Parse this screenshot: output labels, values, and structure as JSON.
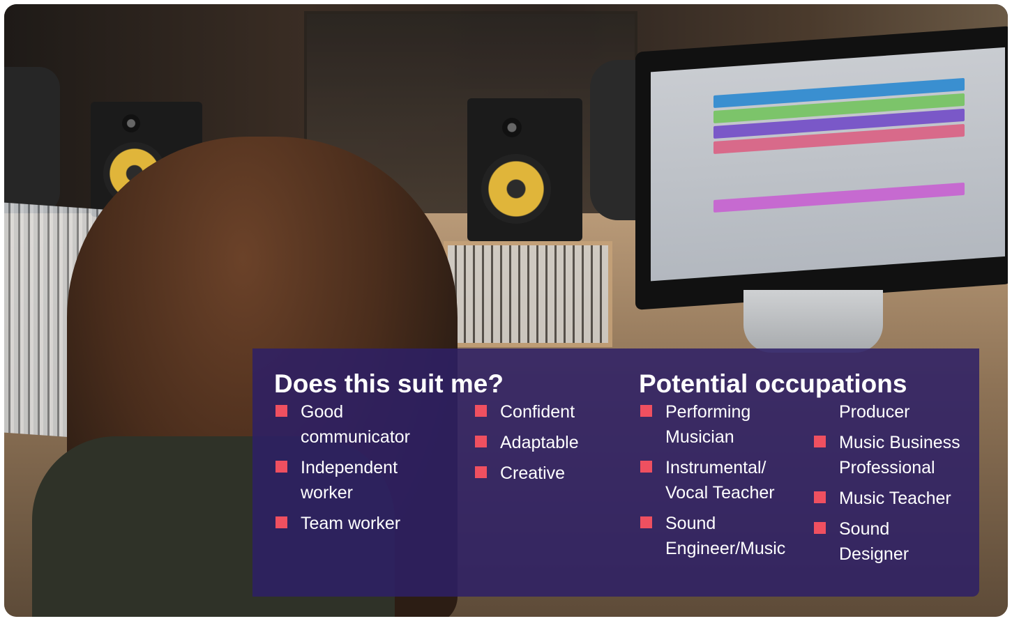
{
  "panel": {
    "left_heading": "Does this suit me?",
    "right_heading": "Potential occupations",
    "suit_col1": [
      "Good\ncommunicator",
      "Independent\nworker",
      "Team worker"
    ],
    "suit_col2": [
      "Confident",
      "Adaptable",
      "Creative"
    ],
    "occ_col1": [
      "Performing\nMusician",
      "Instrumental/\nVocal Teacher",
      "Sound\nEngineer/Music"
    ],
    "occ_col2_continuation": "Producer",
    "occ_col2": [
      "Music Business\nProfessional",
      "Music Teacher",
      "Sound\nDesigner"
    ]
  },
  "colors": {
    "panel_bg": "#2d2066",
    "bullet": "#ef5060",
    "text": "#ffffff"
  }
}
